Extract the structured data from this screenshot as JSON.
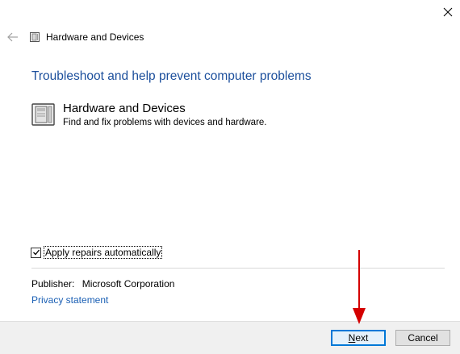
{
  "window": {
    "title": "Hardware and Devices",
    "close_icon": "close-icon",
    "back_icon": "back-arrow-icon"
  },
  "main": {
    "heading": "Troubleshoot and help prevent computer problems",
    "task": {
      "title": "Hardware and Devices",
      "description": "Find and fix problems with devices and hardware.",
      "icon": "hardware-devices-icon"
    },
    "apply_repairs": {
      "label": "Apply repairs automatically",
      "checked": true
    },
    "publisher": {
      "label": "Publisher:",
      "value": "Microsoft Corporation"
    },
    "privacy_link": "Privacy statement"
  },
  "footer": {
    "next_mnemonic": "N",
    "next_rest": "ext",
    "cancel_label": "Cancel"
  },
  "colors": {
    "heading": "#1c4f9c",
    "link": "#1a5fb4",
    "annotation_arrow": "#d40000",
    "default_button_border": "#0078d7"
  }
}
